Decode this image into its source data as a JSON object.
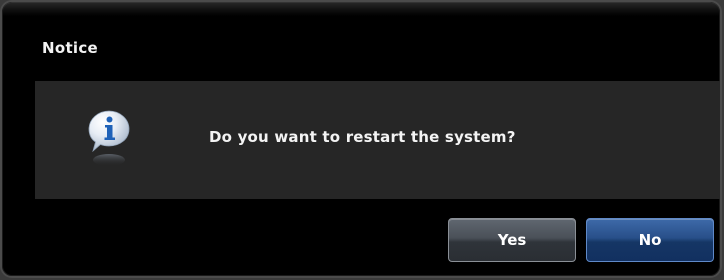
{
  "dialog": {
    "title": "Notice",
    "message": "Do you want to restart the system?",
    "icon": "info-icon",
    "buttons": {
      "yes_label": "Yes",
      "no_label": "No"
    }
  },
  "colors": {
    "dialog_background": "#000000",
    "panel_background": "#262626",
    "text": "#f2f2f2",
    "yes_button": "#4a5058",
    "no_button": "#284f89",
    "icon_blue": "#1f62b8"
  }
}
